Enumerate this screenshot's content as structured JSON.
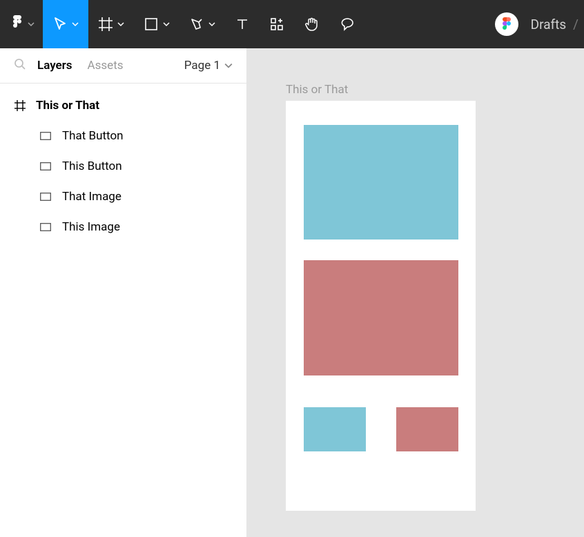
{
  "toolbar": {
    "breadcrumb": {
      "root": "Drafts"
    }
  },
  "sidebar": {
    "tabs": {
      "layers": "Layers",
      "assets": "Assets"
    },
    "page_selector": "Page 1",
    "layers": [
      {
        "name": "This or That",
        "type": "frame"
      },
      {
        "name": "That Button",
        "type": "rect"
      },
      {
        "name": "This Button",
        "type": "rect"
      },
      {
        "name": "That Image",
        "type": "rect"
      },
      {
        "name": "This Image",
        "type": "rect"
      }
    ]
  },
  "canvas": {
    "frame_label": "This or That",
    "colors": {
      "blue": "#7fc6d7",
      "red": "#c97d7d"
    }
  }
}
